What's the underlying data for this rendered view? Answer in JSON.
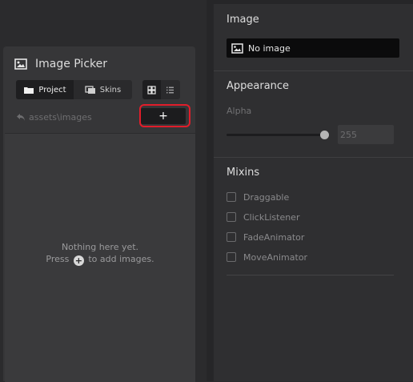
{
  "picker": {
    "title": "Image Picker",
    "tabs": [
      {
        "label": "Project",
        "active": true
      },
      {
        "label": "Skins",
        "active": false
      }
    ],
    "view_modes": [
      "grid-view-icon",
      "list-view-icon"
    ],
    "path": "assets\\images",
    "add_button_label": "+",
    "empty_line1": "Nothing here yet.",
    "empty_line2_pre": "Press",
    "empty_line2_post": "to add images."
  },
  "inspector": {
    "image_section": {
      "title": "Image",
      "value": "No image"
    },
    "appearance_section": {
      "title": "Appearance",
      "alpha_label": "Alpha",
      "alpha_value": "255",
      "alpha_fraction": 1.0
    },
    "mixins_section": {
      "title": "Mixins",
      "items": [
        {
          "label": "Draggable",
          "checked": false
        },
        {
          "label": "ClickListener",
          "checked": false
        },
        {
          "label": "FadeAnimator",
          "checked": false
        },
        {
          "label": "MoveAnimator",
          "checked": false
        }
      ]
    }
  },
  "colors": {
    "highlight": "#e11d2a",
    "field_dark": "#0b0b0c"
  }
}
